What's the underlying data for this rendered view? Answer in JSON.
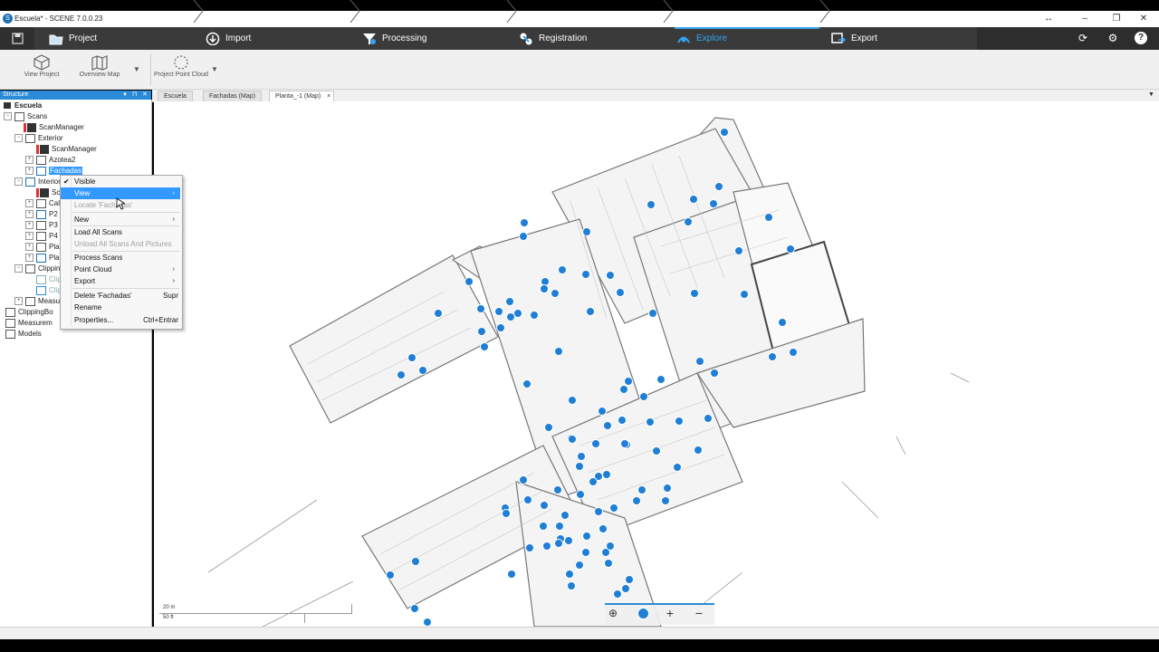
{
  "window": {
    "title": "Escuela* - SCENE 7.0.0.23",
    "controls": [
      "↔",
      "–",
      "❐",
      "✕"
    ]
  },
  "nav": {
    "steps": [
      {
        "label": "Project",
        "icon": "folder-icon"
      },
      {
        "label": "Import",
        "icon": "import-icon"
      },
      {
        "label": "Processing",
        "icon": "processing-icon"
      },
      {
        "label": "Registration",
        "icon": "registration-icon"
      },
      {
        "label": "Explore",
        "icon": "explore-icon"
      },
      {
        "label": "Export",
        "icon": "export-icon"
      }
    ],
    "active": "Explore"
  },
  "toolbar": {
    "view_project": "View Project",
    "overview_map": "Overview Map",
    "project_point_cloud": "Project Point Cloud"
  },
  "structure": {
    "title": "Structure",
    "items": [
      {
        "label": "Escuela"
      },
      {
        "label": "Scans"
      },
      {
        "label": "ScanManager"
      },
      {
        "label": "Exterior"
      },
      {
        "label": "ScanManager"
      },
      {
        "label": "Azotea2"
      },
      {
        "label": "Fachadas"
      },
      {
        "label": "Interior"
      },
      {
        "label": "Sc"
      },
      {
        "label": "Cal"
      },
      {
        "label": "P2"
      },
      {
        "label": "P3"
      },
      {
        "label": "P4"
      },
      {
        "label": "Pla"
      },
      {
        "label": "Pla"
      },
      {
        "label": "Clippin"
      },
      {
        "label": "Clip"
      },
      {
        "label": "Clip"
      },
      {
        "label": "Measu"
      },
      {
        "label": "ClippingBo"
      },
      {
        "label": "Measurem"
      },
      {
        "label": "Models"
      }
    ]
  },
  "tabs": [
    {
      "label": "Escuela"
    },
    {
      "label": "Fachadas (Map)"
    },
    {
      "label": "Planta_-1 (Map)",
      "close": "×"
    }
  ],
  "context_menu": {
    "items": [
      {
        "label": "Visible",
        "check": "✔"
      },
      {
        "label": "View",
        "arrow": "›"
      },
      {
        "label": "Locate 'Fachadas'"
      },
      {
        "label": "New",
        "arrow": "›"
      },
      {
        "label": "Load All Scans"
      },
      {
        "label": "Unload All Scans And Pictures"
      },
      {
        "label": "Process Scans"
      },
      {
        "label": "Point Cloud",
        "arrow": "›"
      },
      {
        "label": "Export",
        "arrow": "›"
      },
      {
        "label": "Delete 'Fachadas'",
        "shortcut": "Supr"
      },
      {
        "label": "Rename"
      },
      {
        "label": "Properties...",
        "shortcut": "Ctrl+Entrar"
      }
    ]
  },
  "map": {
    "scale_metric": "20 m",
    "scale_imperial": "50 ft",
    "zoom_in": "+",
    "zoom_out": "−"
  },
  "colors": {
    "accent": "#35a3f0",
    "scan_point": "#1f7fd6",
    "nav_bg": "#3a3a3a",
    "panel_header": "#2b8ad8"
  }
}
